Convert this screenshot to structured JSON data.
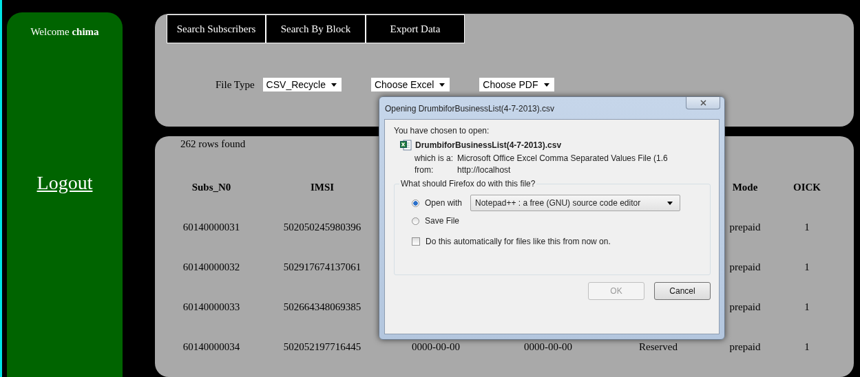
{
  "sidebar": {
    "welcome": "Welcome",
    "user": "chima",
    "logout": "Logout"
  },
  "tabs": [
    {
      "label": "Search Subscribers",
      "selected": false
    },
    {
      "label": "Search By Block",
      "selected": false
    },
    {
      "label": "Export Data",
      "selected": false
    }
  ],
  "filters": {
    "label": "File Type",
    "selects": [
      {
        "value": "CSV_Recycle"
      },
      {
        "value": "Choose Excel"
      },
      {
        "value": "Choose PDF"
      }
    ]
  },
  "results": {
    "count": "262 rows found",
    "columns": [
      "Subs_N0",
      "IMSI",
      null,
      null,
      null,
      "Mode",
      "OICK"
    ],
    "rows": [
      [
        "60140000031",
        "502050245980396",
        null,
        null,
        null,
        "prepaid",
        "1"
      ],
      [
        "60140000032",
        "502917674137061",
        null,
        null,
        null,
        "prepaid",
        "1"
      ],
      [
        "60140000033",
        "502664348069385",
        null,
        null,
        null,
        "prepaid",
        "1"
      ],
      [
        "60140000034",
        "502052197716445",
        "0000-00-00",
        "0000-00-00",
        "Reserved",
        "prepaid",
        "1"
      ]
    ]
  },
  "dialog": {
    "title": "Opening DrumbiforBusinessList(4-7-2013).csv",
    "intro": "You have chosen to open:",
    "file_name": "DrumbiforBusinessList(4-7-2013).csv",
    "type_label": "which is a:",
    "type_value": "Microsoft Office Excel Comma Separated Values File (1.6",
    "from_label": "from:",
    "from_value": "http://localhost",
    "group_title": "What should Firefox do with this file?",
    "options": [
      {
        "label": "Open with",
        "selected": true
      },
      {
        "label": "Save File",
        "selected": false
      }
    ],
    "app": "Notepad++ : a free (GNU) source code editor",
    "auto": {
      "label": "Do this automatically for files like this from now on.",
      "checked": false
    },
    "buttons": [
      {
        "label": "OK",
        "disabled": true
      },
      {
        "label": "Cancel",
        "disabled": false
      }
    ]
  }
}
